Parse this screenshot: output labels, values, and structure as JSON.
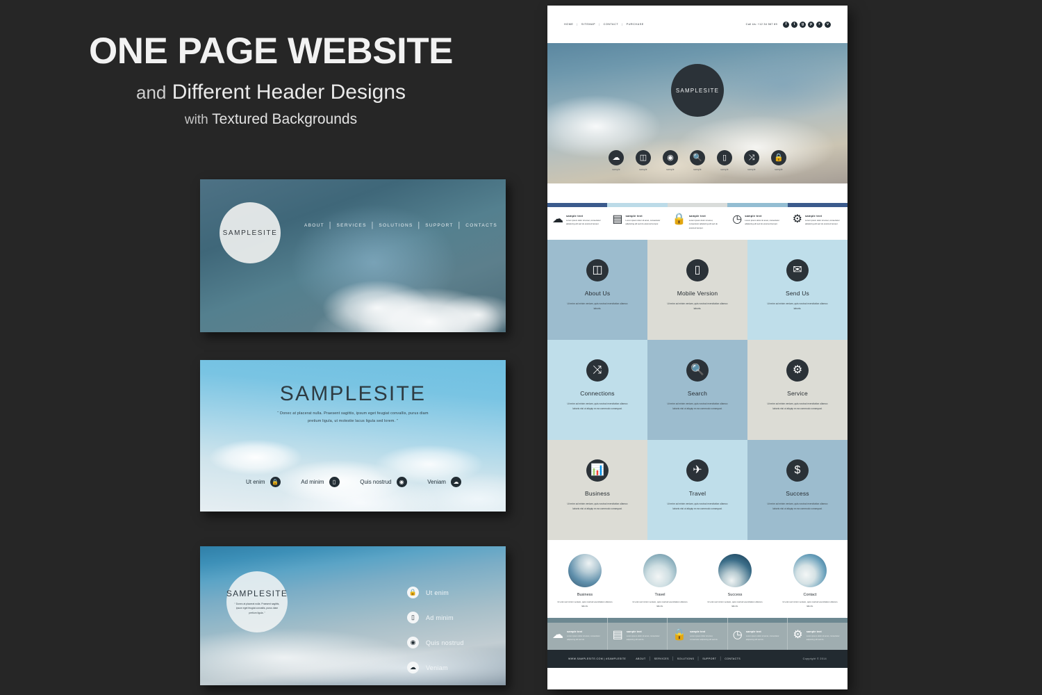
{
  "poster": {
    "title_main": "ONE PAGE WEBSITE",
    "title_sub_thin": "and",
    "title_sub_bold": "Different Header Designs",
    "title_sub2_thin": "with",
    "title_sub2_bold": "Textured Backgrounds"
  },
  "colors": {
    "dark_bg": "#262626",
    "icon_dark": "#2b3238",
    "footer_dark": "#222a30",
    "bar_navy": "#3b5a8c",
    "bar_lightblue": "#bcdbe8",
    "bar_gray": "#d9dcda",
    "bar_midblue": "#93bdd2",
    "tile_bluegray": "#9cbcce",
    "tile_gray": "#dcdcd5",
    "tile_lightblue": "#bfdeea",
    "widget_bg": "#9fadb0",
    "widget_bar": "#6d8891"
  },
  "mock1": {
    "logo": "SAMPLESITE",
    "nav": [
      "ABOUT",
      "SERVICES",
      "SOLUTIONS",
      "SUPPORT",
      "CONTACTS"
    ],
    "separator": "|"
  },
  "mock2": {
    "title": "SAMPLESITE",
    "quote": "“ Donec at placerat nulla. Praesent sagittis, ipsum eget feugiat convallis, purus diam pretium ligula, ut molestie lacus ligula sed lorem. ”",
    "nav": [
      {
        "label": "Ut enim",
        "icon": "lock-icon",
        "glyph": "🔒"
      },
      {
        "label": "Ad minim",
        "icon": "mobile-icon",
        "glyph": "▯"
      },
      {
        "label": "Quis nostrud",
        "icon": "target-icon",
        "glyph": "◉"
      },
      {
        "label": "Veniam",
        "icon": "cloud-icon",
        "glyph": "☁"
      }
    ]
  },
  "mock3": {
    "logo_title": "SAMPLESITE",
    "logo_sub": "“ Donec at placerat nulla. Praesent sagittis, ipsum eget feugiat convallis, purus diam pretium ligula. ”",
    "nav": [
      {
        "label": "Ut enim",
        "icon": "lock-icon",
        "glyph": "🔒"
      },
      {
        "label": "Ad minim",
        "icon": "mobile-icon",
        "glyph": "▯"
      },
      {
        "label": "Quis nostrud",
        "icon": "target-icon",
        "glyph": "◉"
      },
      {
        "label": "Veniam",
        "icon": "cloud-icon",
        "glyph": "☁"
      }
    ]
  },
  "page": {
    "topbar": {
      "nav": [
        "HOME",
        "SITEMAP",
        "CONTACT",
        "PURCHASE"
      ],
      "separator": "|",
      "phone": "Call Us: +12 34 567 89",
      "socials": [
        "facebook-icon",
        "twitter-icon",
        "google-plus-icon",
        "pinterest-icon",
        "rss-icon",
        "vimeo-icon"
      ],
      "social_glyphs": [
        "f",
        "t",
        "g",
        "p",
        "r",
        "v"
      ]
    },
    "hero": {
      "logo": "SAMPLESITE",
      "icons": [
        {
          "name": "cloud-icon",
          "glyph": "☁",
          "label": "sample"
        },
        {
          "name": "book-icon",
          "glyph": "◫",
          "label": "sample"
        },
        {
          "name": "target-icon",
          "glyph": "◉",
          "label": "sample"
        },
        {
          "name": "search-icon",
          "glyph": "🔍",
          "label": "sample"
        },
        {
          "name": "mobile-icon",
          "glyph": "▯",
          "label": "sample"
        },
        {
          "name": "connections-icon",
          "glyph": "⤨",
          "label": "sample"
        },
        {
          "name": "lock-icon",
          "glyph": "🔒",
          "label": "sample"
        }
      ]
    },
    "feature_strip": [
      {
        "icon": "cloud-icon",
        "glyph": "☁",
        "bar_color": "#3b5a8c",
        "heading": "sample text",
        "body": "Lorem ipsum dolor sit amet, consectetur adipiscing elit sed do eiusmod tempor."
      },
      {
        "icon": "document-icon",
        "glyph": "▤",
        "bar_color": "#bcdbe8",
        "heading": "sample text",
        "body": "Lorem ipsum dolor sit amet, consectetur adipiscing elit sed do eiusmod tempor."
      },
      {
        "icon": "lock-icon",
        "glyph": "🔒",
        "bar_color": "#d9dcda",
        "heading": "sample text",
        "body": "Lorem ipsum dolor sit amet, consectetur adipiscing elit sed do eiusmod tempor."
      },
      {
        "icon": "clock-icon",
        "glyph": "◷",
        "bar_color": "#93bdd2",
        "heading": "sample text",
        "body": "Lorem ipsum dolor sit amet, consectetur adipiscing elit sed do eiusmod tempor."
      },
      {
        "icon": "gear-icon",
        "glyph": "⚙",
        "bar_color": "#3b5a8c",
        "heading": "sample text",
        "body": "Lorem ipsum dolor sit amet, consectetur adipiscing elit sed do eiusmod tempor."
      }
    ],
    "tiles": [
      {
        "title": "About Us",
        "icon": "book-icon",
        "glyph": "◫",
        "bg": "#9cbcce",
        "desc": "Ut enim ad minim veniam, quis nostrud exercitation ullamco laboris."
      },
      {
        "title": "Mobile Version",
        "icon": "mobile-icon",
        "glyph": "▯",
        "bg": "#dcdcd5",
        "desc": "Ut enim ad minim veniam, quis nostrud exercitation ullamco laboris."
      },
      {
        "title": "Send Us",
        "icon": "envelope-icon",
        "glyph": "✉",
        "bg": "#bfdeea",
        "desc": "Ut enim ad minim veniam, quis nostrud exercitation ullamco laboris."
      },
      {
        "title": "Connections",
        "icon": "connections-icon",
        "glyph": "⤨",
        "bg": "#bfdeea",
        "desc": "Ut enim ad minim veniam, quis nostrud exercitation ullamco laboris nisi ut aliquip ex ea commodo consequat."
      },
      {
        "title": "Search",
        "icon": "search-icon",
        "glyph": "🔍",
        "bg": "#9cbcce",
        "desc": "Ut enim ad minim veniam, quis nostrud exercitation ullamco laboris nisi ut aliquip ex ea commodo consequat."
      },
      {
        "title": "Service",
        "icon": "gear-icon",
        "glyph": "⚙",
        "bg": "#dcdcd5",
        "desc": "Ut enim ad minim veniam, quis nostrud exercitation ullamco laboris nisi ut aliquip ex ea commodo consequat."
      },
      {
        "title": "Business",
        "icon": "chart-icon",
        "glyph": "📊",
        "bg": "#dcdcd5",
        "desc": "Ut enim ad minim veniam, quis nostrud exercitation ullamco laboris nisi ut aliquip ex ea commodo consequat."
      },
      {
        "title": "Travel",
        "icon": "plane-icon",
        "glyph": "✈",
        "bg": "#bfdeea",
        "desc": "Ut enim ad minim veniam, quis nostrud exercitation ullamco laboris nisi ut aliquip ex ea commodo consequat."
      },
      {
        "title": "Success",
        "icon": "dollar-icon",
        "glyph": "$",
        "bg": "#9cbcce",
        "desc": "Ut enim ad minim veniam, quis nostrud exercitation ullamco laboris nisi ut aliquip ex ea commodo consequat."
      }
    ],
    "gallery": [
      {
        "title": "Business",
        "desc": "Ut enim ad minim veniam, quis nostrud exercitation ullamco laboris."
      },
      {
        "title": "Travel",
        "desc": "Ut enim ad minim veniam, quis nostrud exercitation ullamco laboris."
      },
      {
        "title": "Success",
        "desc": "Ut enim ad minim veniam, quis nostrud exercitation ullamco laboris."
      },
      {
        "title": "Contact",
        "desc": "Ut enim ad minim veniam, quis nostrud exercitation ullamco laboris."
      }
    ],
    "widgets": [
      {
        "icon": "cloud-icon",
        "glyph": "☁",
        "heading": "sample text",
        "body": "Lorem ipsum dolor sit amet, consectetur adipiscing elit sed do."
      },
      {
        "icon": "document-icon",
        "glyph": "▤",
        "heading": "sample text",
        "body": "Lorem ipsum dolor sit amet, consectetur adipiscing elit sed do."
      },
      {
        "icon": "lock-icon",
        "glyph": "🔒",
        "heading": "sample text",
        "body": "Lorem ipsum dolor sit amet, consectetur adipiscing elit sed do."
      },
      {
        "icon": "clock-icon",
        "glyph": "◷",
        "heading": "sample text",
        "body": "Lorem ipsum dolor sit amet, consectetur adipiscing elit sed do."
      },
      {
        "icon": "gear-icon",
        "glyph": "⚙",
        "heading": "sample text",
        "body": "Lorem ipsum dolor sit amet, consectetur adipiscing elit sed do."
      }
    ],
    "footer": {
      "site": "WWW.SAMPLESITE.COM   |   #SAMPLESITE",
      "nav": [
        "ABOUT",
        "SERVICES",
        "SOLUTIONS",
        "SUPPORT",
        "CONTACTS"
      ],
      "separator": "|",
      "copyright": "Copyright © 2014"
    }
  }
}
